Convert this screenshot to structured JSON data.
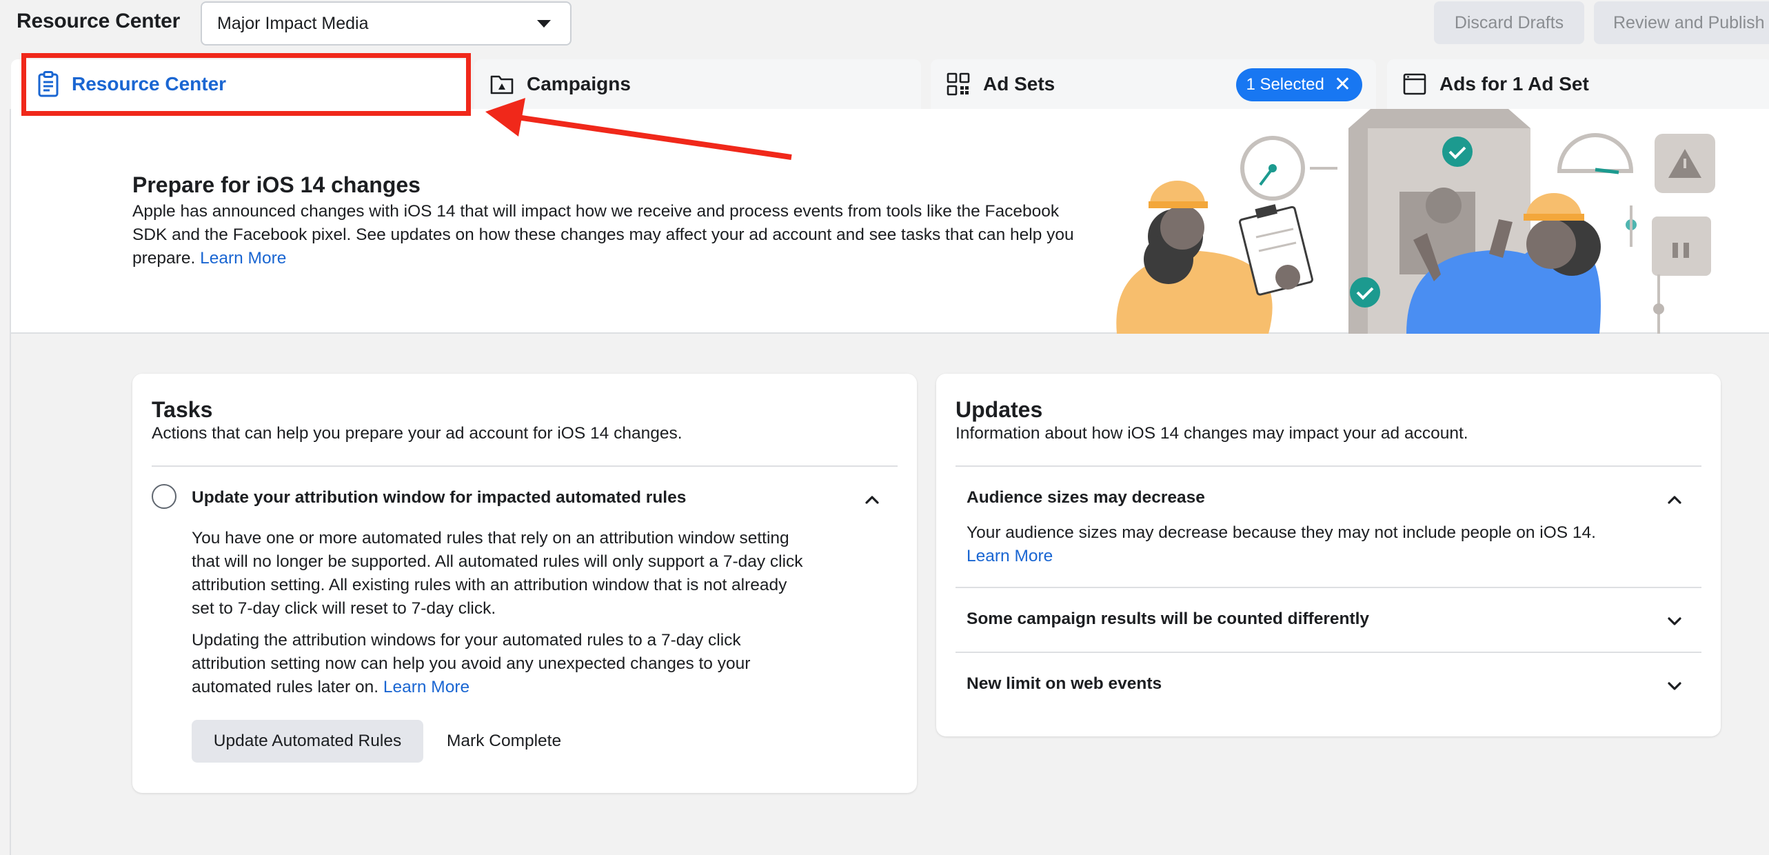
{
  "header": {
    "title": "Resource Center",
    "account_selector": {
      "value": "Major Impact Media"
    },
    "discard_label": "Discard Drafts",
    "review_label": "Review and Publish"
  },
  "tabs": [
    {
      "label": "Resource Center",
      "icon": "clipboard-icon",
      "active": true
    },
    {
      "label": "Campaigns",
      "icon": "folder-icon"
    },
    {
      "label": "Ad Sets",
      "icon": "grid-icon",
      "badge": "1 Selected"
    },
    {
      "label": "Ads for 1 Ad Set",
      "icon": "window-icon"
    }
  ],
  "banner": {
    "title": "Prepare for iOS 14 changes",
    "text": "Apple has announced changes with iOS 14 that will impact how we receive and process events from tools like the Facebook SDK and the Facebook pixel. See updates on how these changes may affect your ad account and see tasks that can help you prepare.",
    "link": "Learn More"
  },
  "tasks": {
    "title": "Tasks",
    "subtitle": "Actions that can help you prepare your ad account for iOS 14 changes.",
    "item": {
      "title": "Update your attribution window for impacted automated rules",
      "paragraph1": "You have one or more automated rules that rely on an attribution window setting that will no longer be supported. All automated rules will only support a 7-day click attribution setting. All existing rules with an attribution window that is not already set to 7-day click will reset to 7-day click.",
      "paragraph2": "Updating the attribution windows for your automated rules to a 7-day click attribution setting now can help you avoid any unexpected changes to your automated rules later on.",
      "link": "Learn More",
      "primary_button": "Update Automated Rules",
      "secondary_button": "Mark Complete"
    }
  },
  "updates": {
    "title": "Updates",
    "subtitle": "Information about how iOS 14 changes may impact your ad account.",
    "items": [
      {
        "title": "Audience sizes may decrease",
        "body": "Your audience sizes may decrease because they may not include people on iOS 14.",
        "link": "Learn More",
        "expanded": true
      },
      {
        "title": "Some campaign results will be counted differently",
        "expanded": false
      },
      {
        "title": "New limit on web events",
        "expanded": false
      }
    ]
  },
  "colors": {
    "accent": "#1877f2",
    "link": "#1a66d2",
    "annotation": "#f0281a"
  }
}
